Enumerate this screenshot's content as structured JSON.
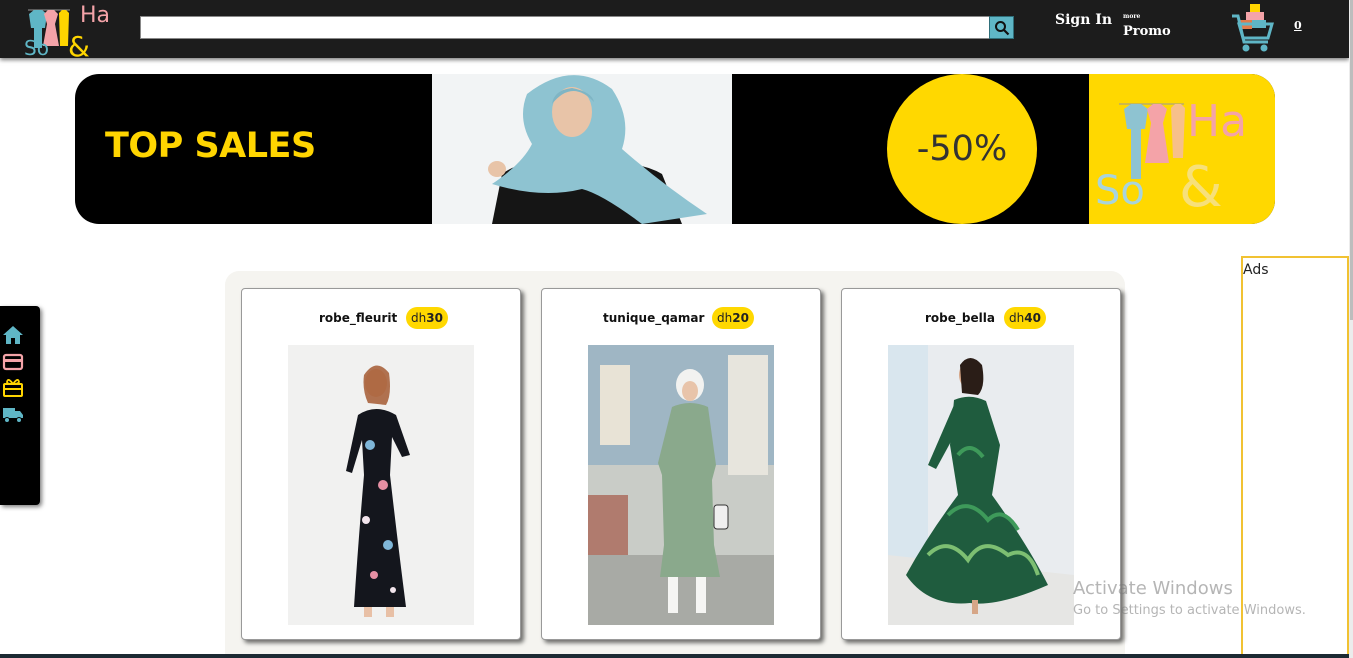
{
  "header": {
    "logo_text_top": "Ha",
    "logo_text_bottom": "So",
    "logo_ampersand": "&",
    "search": {
      "value": "",
      "placeholder": ""
    },
    "search_icon": "search-icon",
    "sign_in_label": "Sign In",
    "promo_small_label": "more",
    "promo_label": "Promo",
    "cart_icon": "shopping-cart-icon",
    "cart_count": "0"
  },
  "banner": {
    "headline": "TOP SALES",
    "discount": "-50%",
    "logo_text_top": "Ha",
    "logo_text_bottom": "So",
    "logo_ampersand": "&"
  },
  "side_menu": {
    "items": [
      {
        "icon": "home-icon",
        "color": "#5fb6c6"
      },
      {
        "icon": "credit-card-icon",
        "color": "#f4a3a8"
      },
      {
        "icon": "gift-icon",
        "color": "#ffd500"
      },
      {
        "icon": "truck-icon",
        "color": "#5fb6c6"
      }
    ]
  },
  "products": [
    {
      "name": "robe_fleurit",
      "currency": "dh",
      "price": "30"
    },
    {
      "name": "tunique_qamar",
      "currency": "dh",
      "price": "20"
    },
    {
      "name": "robe_bella",
      "currency": "dh",
      "price": "40"
    }
  ],
  "ads": {
    "label": "Ads"
  },
  "watermark": {
    "title": "Activate Windows",
    "subtitle": "Go to Settings to activate Windows."
  },
  "colors": {
    "header_bg": "#1c1c1c",
    "accent_yellow": "#ffd800",
    "accent_teal": "#5fb6c6",
    "accent_pink": "#f4a3a8",
    "ads_border": "#f1c232"
  }
}
